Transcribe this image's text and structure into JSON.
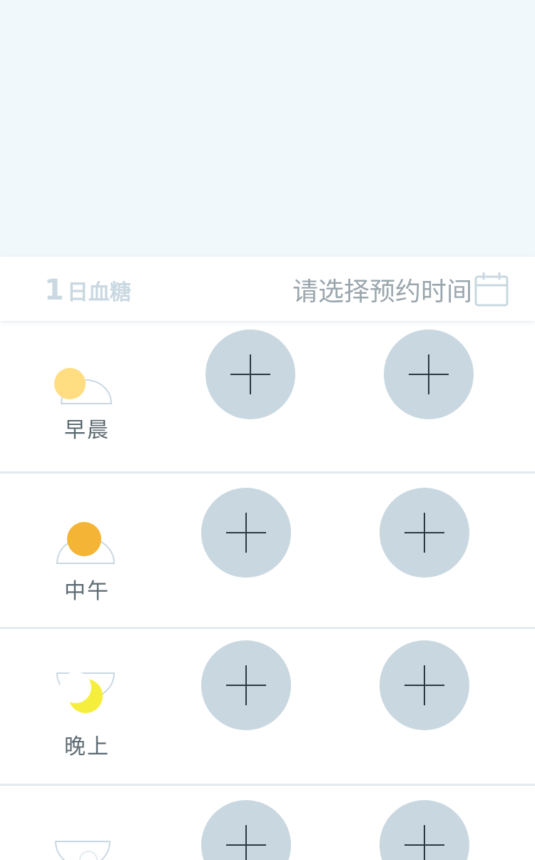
{
  "header": {
    "day_number": "1",
    "day_text": "日血糖",
    "appointment_label": "请选择预约时间"
  },
  "slots": [
    {
      "label": "早晨",
      "icon": "morning-sun-icon"
    },
    {
      "label": "中午",
      "icon": "noon-sun-icon"
    },
    {
      "label": "晚上",
      "icon": "evening-moon-icon"
    },
    {
      "label": "",
      "icon": "night-icon"
    }
  ],
  "colors": {
    "banner_bg": "#f1f8fc",
    "add_button_bg": "#c9d8e0",
    "plus_stroke": "#2b3a44",
    "morning_sun": "#ffdd80",
    "noon_sun": "#f4b537",
    "moon": "#f5ee3c",
    "divider": "#e2ebf0"
  }
}
